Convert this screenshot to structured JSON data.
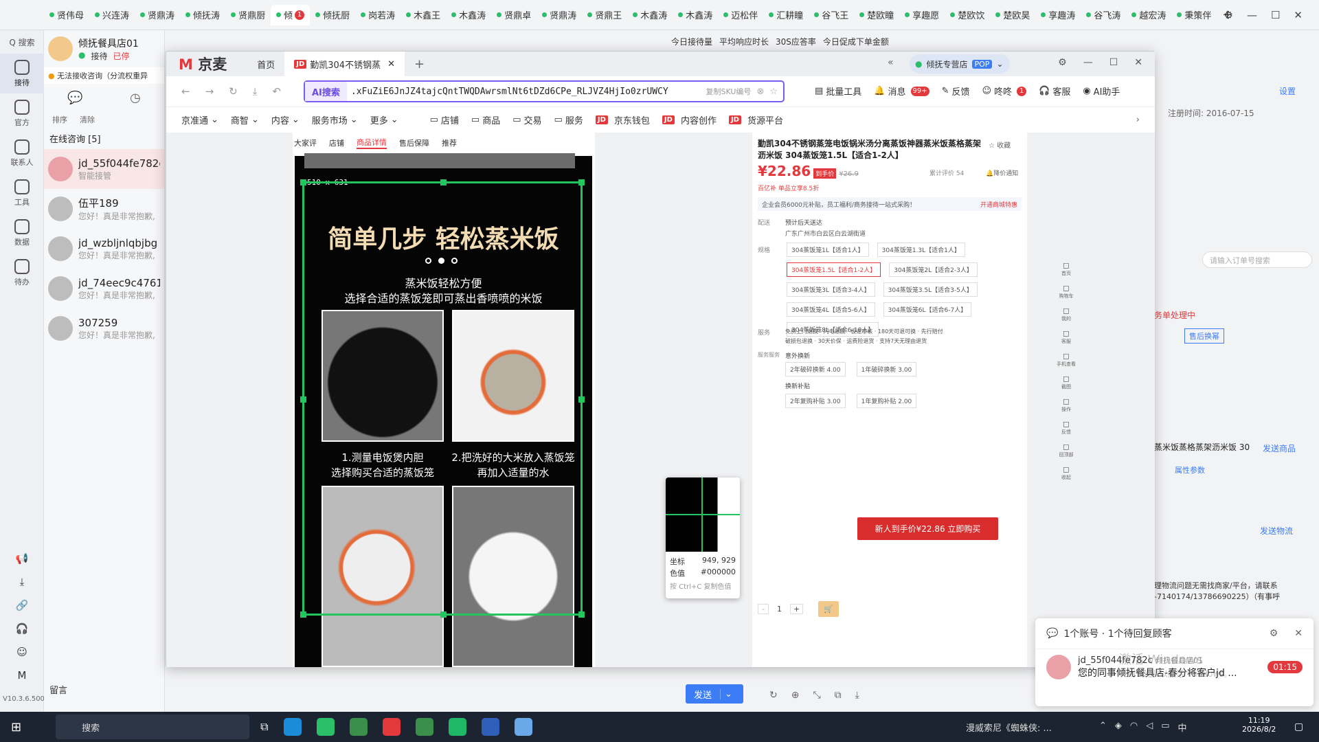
{
  "browser_tabs": [
    {
      "label": "贤伟母"
    },
    {
      "label": "兴连涛"
    },
    {
      "label": "贤鼎涛"
    },
    {
      "label": "倾抚涛"
    },
    {
      "label": "贤鼎厨"
    },
    {
      "label": "倾",
      "badge": "1",
      "active": true
    },
    {
      "label": "倾抚厨"
    },
    {
      "label": "岗若涛"
    },
    {
      "label": "木鑫王"
    },
    {
      "label": "木鑫涛"
    },
    {
      "label": "贤鼎卓"
    },
    {
      "label": "贤鼎涛"
    },
    {
      "label": "贤鼎王"
    },
    {
      "label": "木鑫涛"
    },
    {
      "label": "木鑫涛"
    },
    {
      "label": "迈松伴"
    },
    {
      "label": "汇耕瞳"
    },
    {
      "label": "谷飞王"
    },
    {
      "label": "楚欧瞳"
    },
    {
      "label": "享趣愿"
    },
    {
      "label": "楚欧饮"
    },
    {
      "label": "楚欧昊"
    },
    {
      "label": "享趣涛"
    },
    {
      "label": "谷飞涛"
    },
    {
      "label": "越宏涛"
    },
    {
      "label": "秉策伴"
    }
  ],
  "new_tab": "+",
  "left_rail": {
    "search": "Q 搜索",
    "items": [
      {
        "label": "接待",
        "icon": "chat-bubble-icon",
        "badge": "1"
      },
      {
        "label": "官方",
        "icon": "message-icon"
      },
      {
        "label": "联系人",
        "icon": "contacts-icon"
      },
      {
        "label": "工具",
        "icon": "tools-icon"
      },
      {
        "label": "数据",
        "icon": "data-chart-icon"
      },
      {
        "label": "待办",
        "icon": "todo-icon"
      }
    ],
    "bottom_icons": [
      "megaphone-icon",
      "download-icon",
      "link-icon",
      "headset-icon",
      "emoji-icon",
      "brand-m-icon"
    ],
    "version": "V10.3.6.500"
  },
  "chat_panel": {
    "store_name": "倾抚餐具店01",
    "status": "接待",
    "status2": "已停",
    "warning": "无法接收咨询（分流权重异",
    "sort": "排序",
    "clear": "清除",
    "section": "在线咨询 [5]",
    "chats": [
      {
        "name": "jd_55f044fe782c",
        "preview": "智能接管",
        "badge": "1"
      },
      {
        "name": "伍平189",
        "preview": "您好！真是非常抱歉,"
      },
      {
        "name": "jd_wzbljnlqbjbg",
        "preview": "您好！真是非常抱歉,"
      },
      {
        "name": "jd_74eec9c4761",
        "preview": "您好！真是非常抱歉,"
      },
      {
        "name": "307259",
        "preview": "您好！真是非常抱歉,",
        "tag": "JD客服"
      }
    ],
    "leave_msg": "留言"
  },
  "bg_header": {
    "stats": [
      "今日接待量",
      "平均响应时长",
      "30S应答率",
      "今日促成下单金额"
    ],
    "reg_label": "注册时间:",
    "reg_date": "2016-07-15",
    "settings": "设置",
    "order_search": "请输入订单号搜索",
    "order_processing": "务单处理中",
    "after_sale": "售后换幂",
    "product_snippet": "蒸米饭蒸格蒸架沥米饭 30",
    "send_product": "发送商品",
    "attr": "属性参数",
    "send_logistics": "发送物流",
    "logistics_text": "理物流问题无需找商家/平台，请联系",
    "phone": "-7140174/13786690225）（有事呼",
    "send": "发送"
  },
  "jingmai": {
    "logo": "京麦",
    "tabs": [
      {
        "label": "首页"
      },
      {
        "label": "勤凯304不锈钢蒸",
        "active": true
      }
    ],
    "shop": "倾抚专营店",
    "pop": "POP",
    "search_tag": "AI搜索",
    "search_value": ".xFuZiE6JnJZ4tajcQntTWQDAwrsmlNt6tDZd6CPe_RLJVZ4HjIo0zrUWCY",
    "copy_sku": "复制SKU编号",
    "tools": [
      {
        "label": "批量工具",
        "icon": "batch-icon"
      },
      {
        "label": "消息",
        "icon": "bell-icon",
        "badge": "99+"
      },
      {
        "label": "反馈",
        "icon": "edit-icon"
      },
      {
        "label": "咚咚",
        "icon": "dongdong-icon",
        "badge": "1"
      },
      {
        "label": "客服",
        "icon": "headset-icon"
      },
      {
        "label": "AI助手",
        "icon": "ai-avatar-icon"
      }
    ],
    "menu": [
      {
        "label": "京准通"
      },
      {
        "label": "商智"
      },
      {
        "label": "内容"
      },
      {
        "label": "服务市场"
      },
      {
        "label": "更多"
      }
    ],
    "menu2": [
      {
        "label": "店铺",
        "icon": "folder-icon"
      },
      {
        "label": "商品",
        "icon": "folder-icon"
      },
      {
        "label": "交易",
        "icon": "folder-icon"
      },
      {
        "label": "服务",
        "icon": "folder-icon"
      },
      {
        "label": "京东钱包",
        "jd": true
      },
      {
        "label": "内容创作",
        "jd": true
      },
      {
        "label": "货源平台",
        "jd": true
      }
    ]
  },
  "product_image": {
    "tabs": [
      "大家评",
      "店铺",
      "商品详情",
      "售后保障",
      "推荐"
    ],
    "active_tab": "商品详情",
    "size_label": "510 x 631",
    "headline": "简单几步 轻松蒸米饭",
    "sub1": "蒸米饭轻松方便",
    "sub2": "选择合适的蒸饭笼即可蒸出香喷喷的米饭",
    "step1a": "1.测量电饭煲内胆",
    "step1b": "选择购买合适的蒸饭笼",
    "step2a": "2.把洗好的大米放入蒸饭笼",
    "step2b": "再加入适量的水"
  },
  "color_picker": {
    "coord_label": "坐标",
    "coord": "949, 929",
    "color_label": "色值",
    "color": "#000000",
    "hint": "按 Ctrl+C 复制色值"
  },
  "product_panel": {
    "title": "勤凯304不锈钢蒸笼电饭锅米汤分离蒸饭神器蒸米饭蒸格蒸架沥米饭 304蒸饭笼1.5L【适合1-2人】",
    "fav": "收藏",
    "price": "¥22.86",
    "price_tag": "到手价",
    "orig_price": "¥26.9",
    "reviews": "累计评价 54",
    "notify": "降价通知",
    "promo": "百亿补",
    "promo2": "单品立享8.5折",
    "member": "企业会员6000元补贴，员工福利/商务接待一站式采购！",
    "member_btn": "开通商城特惠",
    "ship_label": "配送",
    "ship_time": "预计后天送达",
    "ship_addr": "广东广州市白云区白云湖街道",
    "spec_label": "规格",
    "specs": [
      {
        "label": "304蒸饭笼1L【适合1人】"
      },
      {
        "label": "304蒸饭笼1.3L【适合1人】"
      },
      {
        "label": "304蒸饭笼1.5L【适合1-2人】",
        "on": true
      },
      {
        "label": "304蒸饭笼2L【适合2-3人】"
      },
      {
        "label": "304蒸饭笼3L【适合3-4人】"
      },
      {
        "label": "304蒸饭笼3.5L【适合3-5人】"
      },
      {
        "label": "304蒸饭笼4L【适合5-6人】"
      },
      {
        "label": "304蒸饭笼6L【适合6-7人】"
      },
      {
        "label": "304蒸饭笼8L【适合6-10人】"
      }
    ],
    "service_label": "服务",
    "service1": "免费上门退换 · 闪电退款 · 极速审核 · 180天可退可换 · 先行赔付",
    "service2": "破损包退换 · 30天价保 · 运费险退货 · 支持7天无理由退货",
    "extra_label": "服务服务",
    "extra_title": "意外换新",
    "extra_opts": [
      "2年破碎换新 4.00",
      "1年破碎换新 3.00"
    ],
    "trade_title": "换新补贴",
    "trade_opts": [
      "2年复购补贴 3.00",
      "1年复购补贴 2.00"
    ],
    "qty": "1",
    "cta": "新人到手价¥22.86 立即购买"
  },
  "right_side_icons": [
    {
      "label": "首页"
    },
    {
      "label": "购物车"
    },
    {
      "label": "我的"
    },
    {
      "label": "客服"
    },
    {
      "label": "手机查看"
    },
    {
      "label": "截图"
    },
    {
      "label": "操作"
    },
    {
      "label": "反馈"
    },
    {
      "label": "回顶部"
    },
    {
      "label": "收起"
    }
  ],
  "notification": {
    "title": "1个账号 · 1个待回复顾客",
    "user": "jd_55f044fe782c",
    "shop": "倾抚餐具店01",
    "msg": "您的同事倾抚餐具店-春分将客户jd ...",
    "timer": "01:15",
    "activate": "激活 Windows",
    "activate2": "转到\"设置\"以激活 Windows。"
  },
  "taskbar": {
    "search": "搜索",
    "media": "漫威索尼《蜘蛛侠: ...",
    "time": "11:19",
    "date": "2026/8/2",
    "ime": "中"
  },
  "colors": {
    "accent": "#e4393c",
    "green": "#22c55e",
    "ai": "#7a5cf0"
  }
}
